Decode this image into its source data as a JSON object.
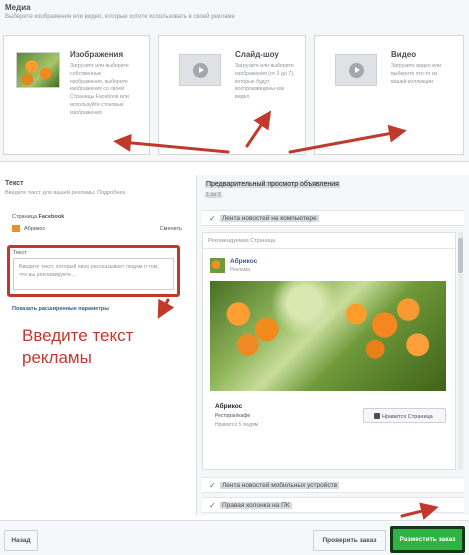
{
  "media": {
    "title": "Медиа",
    "subtitle": "Выберите изображения или видео, которые хотите использовать в своей рекламе",
    "cards": [
      {
        "title": "Изображения",
        "description": "Загрузите или выберите собственные изображения, выберите изображения со своей Страницы Facebook или используйте стоковые изображения",
        "icon": "image-thumbnail-icon"
      },
      {
        "title": "Слайд-шоу",
        "description": "Загрузите или выберите изображения (от 3 до 7), которые будут воспроизведены как видео",
        "icon": "slideshow-play-icon"
      },
      {
        "title": "Видео",
        "description": "Загрузите видео или выберите что-то из вашей коллекции",
        "icon": "video-play-icon"
      }
    ]
  },
  "text_section": {
    "title": "Текст",
    "subtitle": "Введите текст для вашей рекламы. Подробнее.",
    "page_label_prefix": "Страница ",
    "page_label_bold": "Facebook",
    "page_name": "Абрикос",
    "change_label": "Сменить",
    "field_label": "Текст",
    "field_placeholder": "Введите текст, который явно рассказывает людям о том, что вы рекламируете...",
    "advanced_link": "Показать расширенные параметры",
    "annotation_line1": "Введите текст",
    "annotation_line2": "рекламы"
  },
  "preview": {
    "title": "Предварительный просмотр объявления",
    "count": "1 из 1",
    "placements": [
      {
        "label": "Лента новостей на компьютере"
      },
      {
        "label": "Лента новостей мобильных устройств"
      },
      {
        "label": "Правая колонка на ПК"
      }
    ],
    "recommended": "Рекомендуемая Страница",
    "page_name": "Абрикос",
    "sponsored": "Реклама",
    "ad_title": "Абрикос",
    "ad_category": "Ресторан/кафе",
    "ad_likes": "Нравится 5 людям",
    "like_button": "Нравится Страница"
  },
  "footer": {
    "back_label": "Назад",
    "check_label": "Проверить заказ",
    "place_label": "Разместить заказ"
  },
  "colors": {
    "annotation_red": "#c0392b",
    "place_button_green": "#2fb343",
    "link_blue": "#365899"
  }
}
